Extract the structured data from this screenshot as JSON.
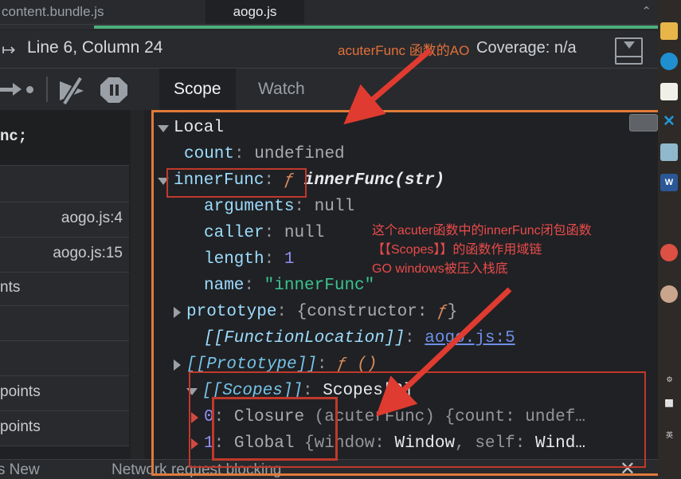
{
  "tabs": {
    "items": [
      {
        "label": "content.bundle.js",
        "active": false
      },
      {
        "label": "aogo.js",
        "active": true
      }
    ],
    "chevron": "⌃"
  },
  "status": {
    "nav_arrow": "↦",
    "line_column": "Line 6, Column 24",
    "coverage": "Coverage: n/a"
  },
  "debug_toolbar": {
    "step_out": "step-out",
    "deactivate_breakpoints": "deactivate-breakpoints",
    "pause_on_exceptions": "pause-on-exceptions"
  },
  "pane_tabs": [
    {
      "label": "Scope",
      "active": true
    },
    {
      "label": "Watch",
      "active": false
    }
  ],
  "left_column": {
    "rows": [
      {
        "text": "nc;",
        "align": "left",
        "code": true
      },
      {
        "text": "",
        "align": "left",
        "code": false
      },
      {
        "text": "aogo.js:4",
        "align": "right",
        "code": false
      },
      {
        "text": "aogo.js:15",
        "align": "right",
        "code": false
      },
      {
        "text": "nts",
        "align": "left",
        "code": false
      },
      {
        "text": "",
        "align": "left",
        "code": false
      },
      {
        "text": "",
        "align": "left",
        "code": false
      },
      {
        "text": "points",
        "align": "left",
        "code": false
      },
      {
        "text": "points",
        "align": "left",
        "code": false
      }
    ]
  },
  "scope": {
    "rows": [
      {
        "indent": 12,
        "arrow": "down",
        "parts": [
          {
            "t": "Local",
            "c": "k-white"
          }
        ]
      },
      {
        "indent": 45,
        "arrow": "none",
        "parts": [
          {
            "t": "count",
            "c": "k-name"
          },
          {
            "t": ": ",
            "c": "k-dim"
          },
          {
            "t": "undefined",
            "c": "k-val"
          }
        ]
      },
      {
        "indent": 12,
        "arrow": "down",
        "parts": [
          {
            "t": "innerFunc",
            "c": "k-name"
          },
          {
            "t": ": ",
            "c": "k-dim"
          },
          {
            "t": "ƒ ",
            "c": "k-fn"
          },
          {
            "t": "innerFunc(str)",
            "c": "k-white-italic"
          }
        ]
      },
      {
        "indent": 70,
        "arrow": "none",
        "parts": [
          {
            "t": "arguments",
            "c": "k-name"
          },
          {
            "t": ": ",
            "c": "k-dim"
          },
          {
            "t": "null",
            "c": "k-val"
          }
        ]
      },
      {
        "indent": 70,
        "arrow": "none",
        "parts": [
          {
            "t": "caller",
            "c": "k-name"
          },
          {
            "t": ": ",
            "c": "k-dim"
          },
          {
            "t": "null",
            "c": "k-val"
          }
        ]
      },
      {
        "indent": 70,
        "arrow": "none",
        "parts": [
          {
            "t": "length",
            "c": "k-name"
          },
          {
            "t": ": ",
            "c": "k-dim"
          },
          {
            "t": "1",
            "c": "k-num"
          }
        ]
      },
      {
        "indent": 70,
        "arrow": "none",
        "parts": [
          {
            "t": "name",
            "c": "k-name"
          },
          {
            "t": ": ",
            "c": "k-dim"
          },
          {
            "t": "\"innerFunc\"",
            "c": "k-str"
          }
        ]
      },
      {
        "indent": 48,
        "arrow": "right",
        "parts": [
          {
            "t": "prototype",
            "c": "k-name"
          },
          {
            "t": ": ",
            "c": "k-dim"
          },
          {
            "t": "{constructor: ",
            "c": "k-val"
          },
          {
            "t": "ƒ",
            "c": "k-fn"
          },
          {
            "t": "}",
            "c": "k-val"
          }
        ]
      },
      {
        "indent": 70,
        "arrow": "none",
        "parts": [
          {
            "t": "[[FunctionLocation]]",
            "c": "k-italic"
          },
          {
            "t": ": ",
            "c": "k-dim"
          },
          {
            "t": "aogo.js:5",
            "c": "k-link"
          }
        ]
      },
      {
        "indent": 48,
        "arrow": "right",
        "parts": [
          {
            "t": "[[Prototype]]",
            "c": "k-proto"
          },
          {
            "t": ": ",
            "c": "k-dim"
          },
          {
            "t": "ƒ ()",
            "c": "k-fn"
          }
        ]
      },
      {
        "indent": 48,
        "arrow": "down",
        "parts": [
          {
            "t": "[[Scopes]]",
            "c": "k-proto"
          },
          {
            "t": ": ",
            "c": "k-dim"
          },
          {
            "t": "Scopes[2]",
            "c": "k-white"
          }
        ]
      },
      {
        "indent": 70,
        "arrow": "right-red",
        "parts": [
          {
            "t": "0",
            "c": "k-num"
          },
          {
            "t": ": ",
            "c": "k-dim"
          },
          {
            "t": "Closure",
            "c": "k-val"
          },
          {
            "t": " (acuterFunc) {count: undef…",
            "c": "k-dim"
          }
        ]
      },
      {
        "indent": 70,
        "arrow": "right-red",
        "parts": [
          {
            "t": "1",
            "c": "k-num"
          },
          {
            "t": ": ",
            "c": "k-dim"
          },
          {
            "t": "Global",
            "c": "k-val"
          },
          {
            "t": " {window: ",
            "c": "k-dim"
          },
          {
            "t": "Window",
            "c": "k-white"
          },
          {
            "t": ", self: ",
            "c": "k-dim"
          },
          {
            "t": "Wind…",
            "c": "k-white"
          }
        ]
      }
    ]
  },
  "annotations": {
    "ao_label": "acuterFunc 函数的AO",
    "chinese_lines": [
      "这个acuter函数中的innerFunc闭包函数",
      "【【Scopes】】的函数作用域链",
      "GO windows被压入栈底"
    ]
  },
  "drawer": {
    "whats_new": "t's New",
    "network_request_blocking": "Network request blocking",
    "close": "✕"
  },
  "taskbar": {
    "icons": [
      {
        "name": "folder-icon",
        "glyph": "",
        "bg": "#e8b54a"
      },
      {
        "name": "edge-icon",
        "glyph": "",
        "bg": "#1f8fd0"
      },
      {
        "name": "chart-app-icon",
        "glyph": "",
        "bg": "#f0f0e8"
      },
      {
        "name": "blue-x-icon",
        "glyph": "✕",
        "bg": "transparent"
      },
      {
        "name": "notebook-icon",
        "glyph": "",
        "bg": "#8fb8cc"
      },
      {
        "name": "word-icon",
        "glyph": "W",
        "bg": "#2b5797"
      },
      {
        "name": "chrome-icon",
        "glyph": "",
        "bg": "#dd5044"
      },
      {
        "name": "avatar-icon",
        "glyph": "",
        "bg": "#c9a58d"
      }
    ],
    "tray": [
      "⚙",
      "⬜",
      "英"
    ]
  },
  "colors": {
    "accent_orange": "#e07b3a",
    "annotation_red": "#e94b4b",
    "highlight_red": "#c0392b",
    "progress_green": "#4caf7d",
    "panel_bg": "#202124",
    "toolbar_bg": "#292a2d"
  }
}
